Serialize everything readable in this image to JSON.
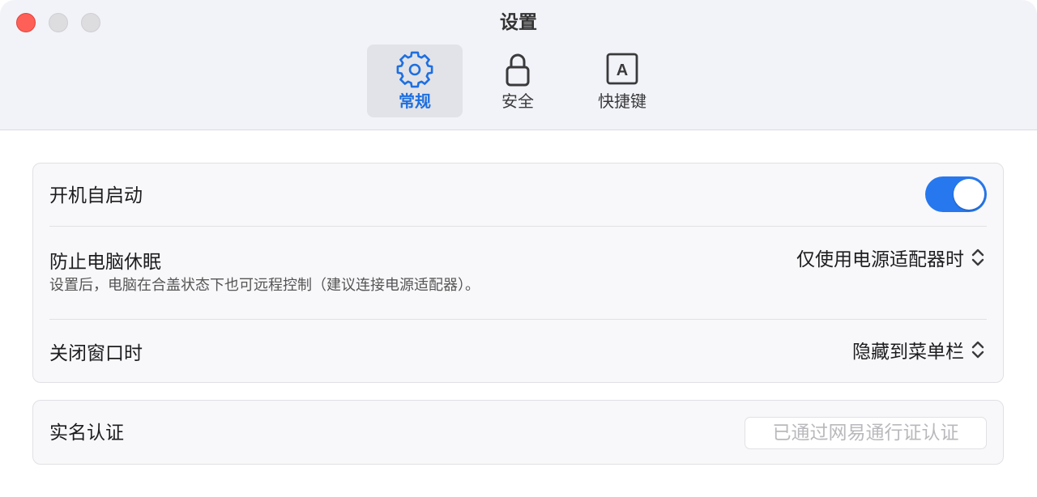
{
  "window": {
    "title": "设置"
  },
  "tabs": [
    {
      "label": "常规",
      "icon": "gear-icon",
      "active": true
    },
    {
      "label": "安全",
      "icon": "lock-icon",
      "active": false
    },
    {
      "label": "快捷键",
      "icon": "keyboard-key-a-icon",
      "active": false
    }
  ],
  "tab_key_letter": "A",
  "settings": {
    "auto_start": {
      "label": "开机自启动",
      "enabled": true
    },
    "prevent_sleep": {
      "label": "防止电脑休眠",
      "description": "设置后，电脑在合盖状态下也可远程控制（建议连接电源适配器）。",
      "value": "仅使用电源适配器时"
    },
    "close_window": {
      "label": "关闭窗口时",
      "value": "隐藏到菜单栏"
    }
  },
  "verification": {
    "label": "实名认证",
    "status": "已通过网易通行证认证"
  },
  "colors": {
    "accent": "#2778ee",
    "close": "#fe5f57",
    "active_tab_text": "#1e6fe0"
  }
}
